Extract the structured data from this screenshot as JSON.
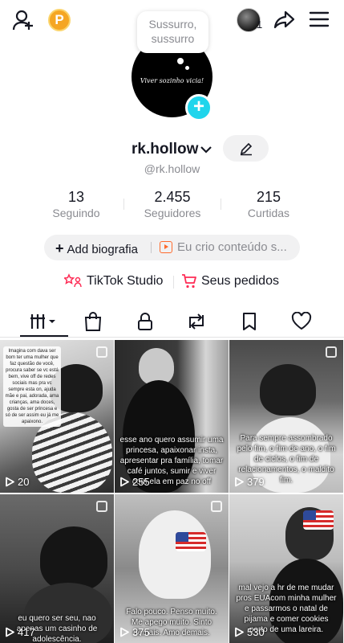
{
  "topbar": {
    "add_user_icon": "add-user-icon",
    "coin_label": "P",
    "mini_avatar_count": "1",
    "share_icon": "share-icon",
    "menu_icon": "hamburger-menu-icon"
  },
  "profile": {
    "bubble_text_line1": "Sussurro,",
    "bubble_text_line2": "sussurro",
    "picture_text": "Viver sozinho vicia!",
    "add_badge": "+",
    "username": "rk.hollow",
    "handle": "@rk.hollow"
  },
  "stats": [
    {
      "value": "13",
      "label": "Seguindo"
    },
    {
      "value": "2.455",
      "label": "Seguidores"
    },
    {
      "value": "215",
      "label": "Curtidas"
    }
  ],
  "bio": {
    "add_label": "Add biografia",
    "add_plus": "+",
    "creator_text": "Eu crio conteúdo s..."
  },
  "links": {
    "studio_label": "TikTok Studio",
    "orders_label": "Seus pedidos"
  },
  "tabs": [
    {
      "name": "videos-grid-icon",
      "active": true
    },
    {
      "name": "shop-bag-icon",
      "active": false
    },
    {
      "name": "lock-icon",
      "active": false
    },
    {
      "name": "repost-icon",
      "active": false
    },
    {
      "name": "bookmark-icon",
      "active": false
    },
    {
      "name": "heart-icon",
      "active": false
    }
  ],
  "videos": [
    {
      "views": "20",
      "caption": "Imagina com dava ser bom ter uma mulher que faz questão de você, procura saber se vc está bem, vive off de redes sociais mas pra vc sempre esta on, ajuda mãe e pai, adorada, ama crianças, ama doces, gosta de ser princesa e só de ser assim eu já me apaixono."
    },
    {
      "views": "255",
      "caption": "esse ano quero assumir uma princesa, apaixonar insta, apresentar pra família, tomar café juntos, sumir e viver com ela em paz no off"
    },
    {
      "views": "379",
      "caption": "Para sempre assombrado pelo fim, o fim de ano, o fim de ciclos, o fim de relacionamentos, o maldito fim."
    },
    {
      "views": "417",
      "caption": "eu quero ser seu, nao apenas um casinho de adolescência."
    },
    {
      "views": "375",
      "caption": "Falo pouco. Penso muito. Me apego muito. Sinto demais. Amo demais."
    },
    {
      "views": "530",
      "caption": "mal vejo a hr de me mudar pros EUAcom minha mulher e passarmos o natal de pijama e comer cookies perto de uma lareira."
    }
  ],
  "colors": {
    "accent_cyan": "#20d5ec",
    "coin_orange": "#f5a623",
    "studio_red": "#fe2c55",
    "text_primary": "#161823",
    "text_secondary": "#8a8b91"
  }
}
